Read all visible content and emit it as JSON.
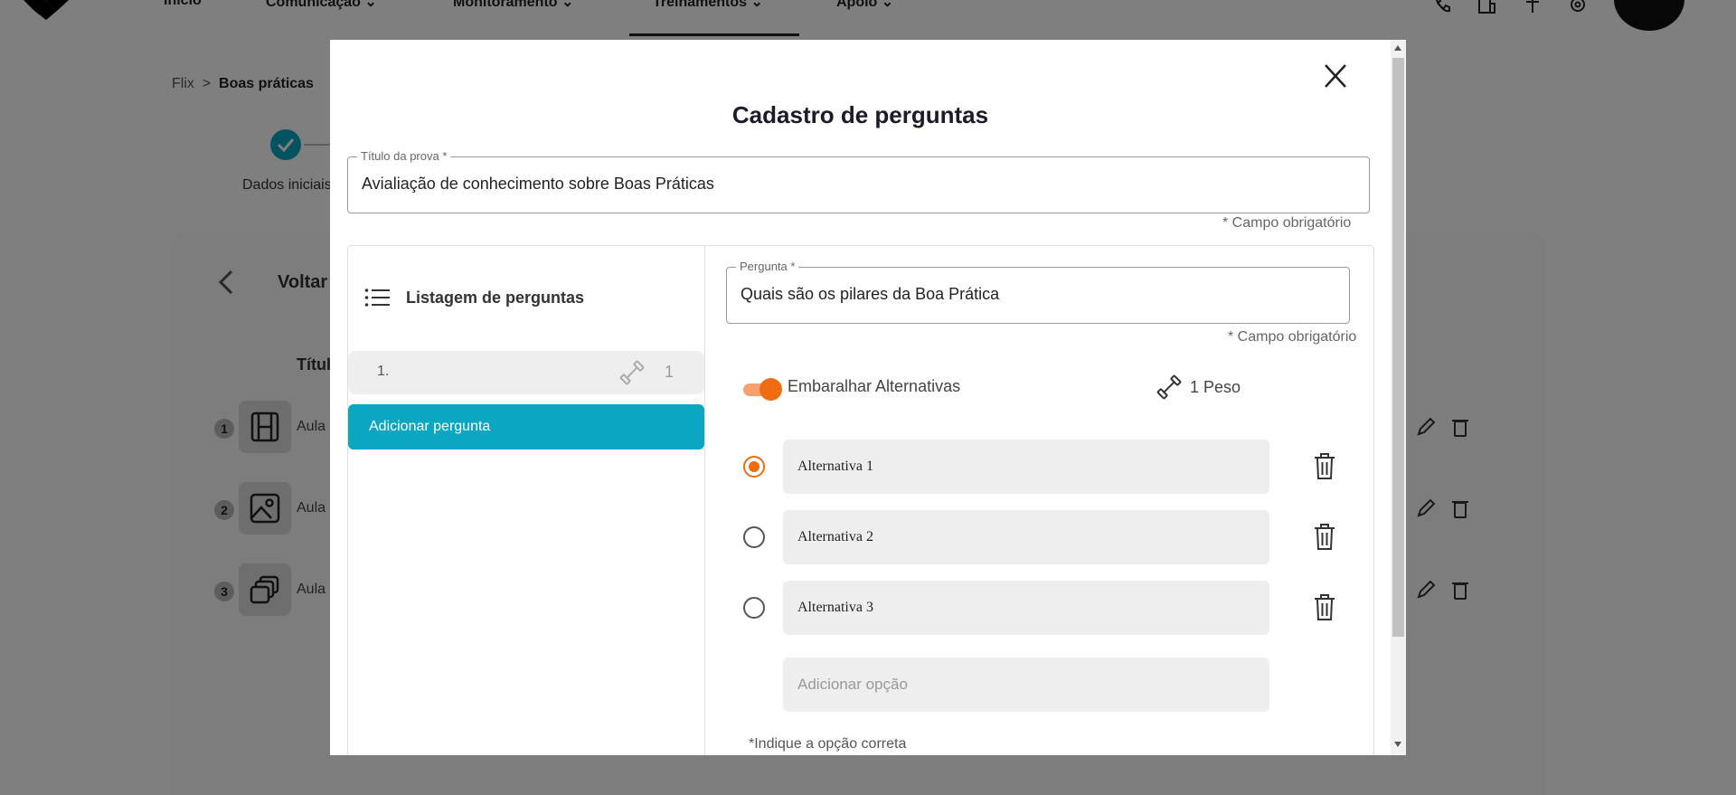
{
  "background": {
    "nav": {
      "items": [
        "Início",
        "Comunicação",
        "Monitoramento",
        "Treinamentos",
        "Apoio"
      ]
    },
    "breadcrumb": {
      "root": "Flix",
      "separator": ">",
      "current": "Boas práticas"
    },
    "stepper": {
      "first_label": "Dados iniciais"
    },
    "card": {
      "back_label": "Voltar",
      "column_title": "Título",
      "rows": [
        {
          "num": "1",
          "label": "Aula"
        },
        {
          "num": "2",
          "label": "Aula"
        },
        {
          "num": "3",
          "label": "Aula"
        }
      ]
    }
  },
  "modal": {
    "title": "Cadastro de perguntas",
    "exam_title_label": "Título da prova *",
    "exam_title_value": "Avialiação de conhecimento sobre Boas Práticas",
    "required_note": "* Campo obrigatório",
    "list": {
      "title": "Listagem de perguntas",
      "items": [
        {
          "num": "1.",
          "weight": "1"
        }
      ],
      "add_button": "Adicionar pergunta"
    },
    "question": {
      "label": "Pergunta *",
      "value": "Quais são os pilares da Boa Prática",
      "required_note": "* Campo obrigatório",
      "shuffle_label": "Embaralhar Alternativas",
      "shuffle_on": true,
      "peso_label": "1 Peso",
      "alternatives": [
        {
          "text": "Alternativa 1",
          "correct": true
        },
        {
          "text": "Alternativa 2",
          "correct": false
        },
        {
          "text": "Alternativa 3",
          "correct": false
        }
      ],
      "add_option_placeholder": "Adicionar opção",
      "hint": "*Indique a opção correta"
    }
  },
  "colors": {
    "accent_teal": "#0aa6c2",
    "accent_orange": "#ee6d12"
  }
}
